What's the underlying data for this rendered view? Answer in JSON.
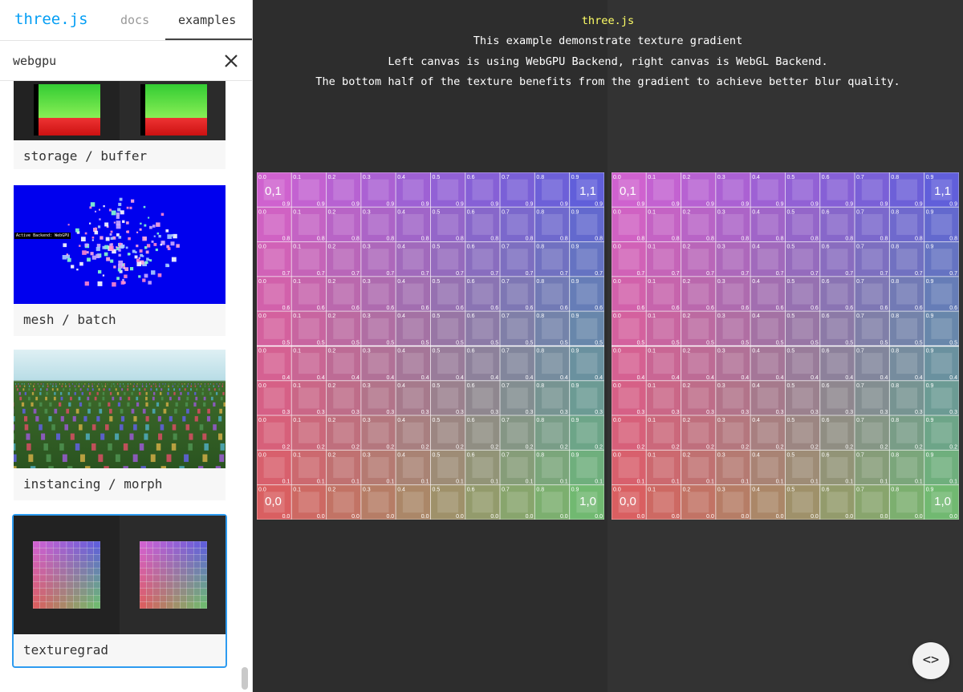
{
  "header": {
    "logo": "three.js",
    "tabs": [
      "docs",
      "examples"
    ],
    "active_tab": "examples"
  },
  "search": {
    "value": "webgpu",
    "clear_icon": "close-icon"
  },
  "examples": [
    {
      "label": "storage / buffer"
    },
    {
      "label": "mesh / batch",
      "thumb_text": "Active Backend: WebGPU"
    },
    {
      "label": "instancing / morph"
    },
    {
      "label": "texturegrad",
      "selected": true
    }
  ],
  "info": {
    "title": "three.js",
    "line1": "This example demonstrate texture gradient",
    "line2": "Left canvas is using WebGPU Backend, right canvas is WebGL Backend.",
    "line3": "The bottom half of the texture benefits from the gradient to achieve better blur quality."
  },
  "texture": {
    "corners": {
      "top_left": "0,1",
      "top_right": "1,1",
      "bottom_left": "0,0",
      "bottom_right": "1,0"
    },
    "cell_values": [
      "0.0",
      "0.1",
      "0.2",
      "0.3",
      "0.4",
      "0.5",
      "0.6",
      "0.7",
      "0.8",
      "0.9"
    ],
    "colors": {
      "top_left": "#d563d5",
      "top_right": "#5a5ae0",
      "bottom_left": "#df5a5a",
      "bottom_right": "#6cc36c"
    }
  },
  "code_button": {
    "label": "<>",
    "icon": "code-icon"
  },
  "accent_color": "#049ef4",
  "selection_color": "#2d9bf0"
}
